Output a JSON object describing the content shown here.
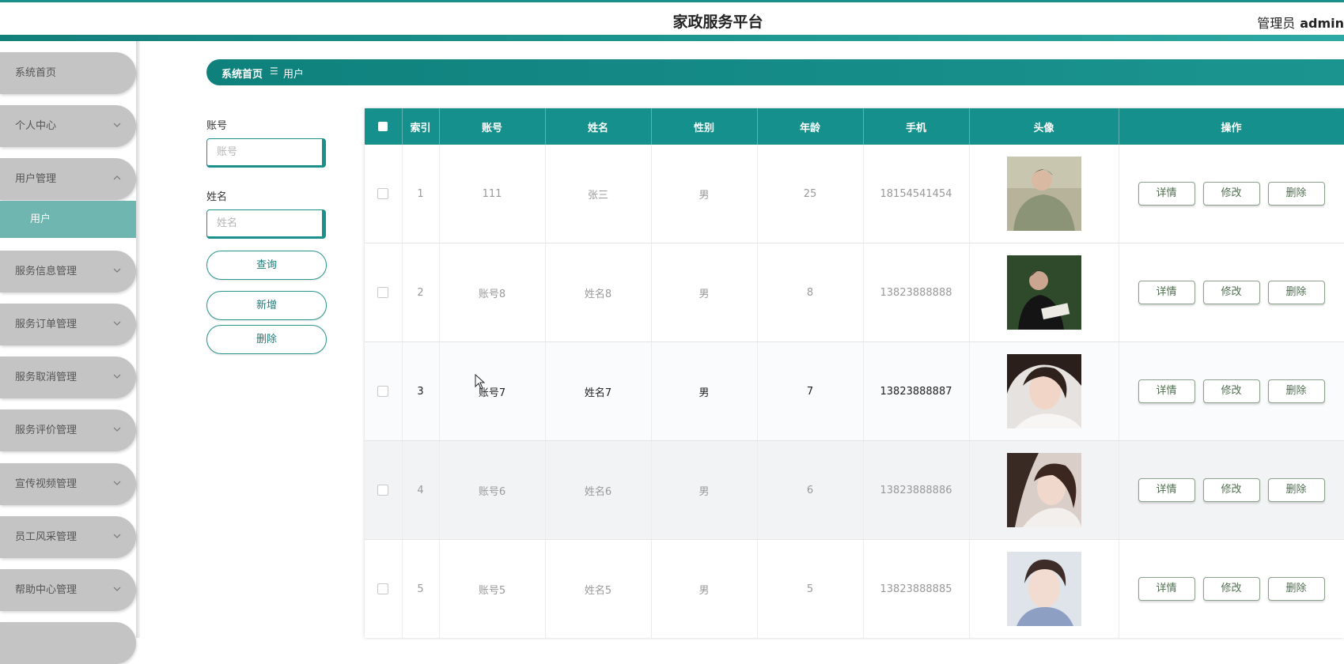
{
  "header": {
    "title": "家政服务平台",
    "role": "管理员",
    "username": "admin"
  },
  "sidebar": {
    "items": [
      {
        "label": "系统首页",
        "chevron": "none"
      },
      {
        "label": "个人中心",
        "chevron": "down"
      },
      {
        "label": "用户管理",
        "chevron": "up"
      },
      {
        "label": "服务信息管理",
        "chevron": "down"
      },
      {
        "label": "服务订单管理",
        "chevron": "down"
      },
      {
        "label": "服务取消管理",
        "chevron": "down"
      },
      {
        "label": "服务评价管理",
        "chevron": "down"
      },
      {
        "label": "宣传视频管理",
        "chevron": "down"
      },
      {
        "label": "员工风采管理",
        "chevron": "down"
      },
      {
        "label": "帮助中心管理",
        "chevron": "down"
      }
    ],
    "subitem": {
      "label": "用户"
    }
  },
  "breadcrumb": {
    "home": "系统首页",
    "separator": "☰",
    "current": "用户"
  },
  "search": {
    "account_label": "账号",
    "account_placeholder": "账号",
    "name_label": "姓名",
    "name_placeholder": "姓名",
    "query_button": "查询",
    "add_button": "新增",
    "delete_button": "删除"
  },
  "table": {
    "headers": [
      "索引",
      "账号",
      "姓名",
      "性别",
      "年龄",
      "手机",
      "头像",
      "操作"
    ],
    "rows": [
      {
        "index": "1",
        "account": "111",
        "name": "张三",
        "gender": "男",
        "age": "25",
        "phone": "18154541454"
      },
      {
        "index": "2",
        "account": "账号8",
        "name": "姓名8",
        "gender": "男",
        "age": "8",
        "phone": "13823888888"
      },
      {
        "index": "3",
        "account": "账号7",
        "name": "姓名7",
        "gender": "男",
        "age": "7",
        "phone": "13823888887"
      },
      {
        "index": "4",
        "account": "账号6",
        "name": "姓名6",
        "gender": "男",
        "age": "6",
        "phone": "13823888886"
      },
      {
        "index": "5",
        "account": "账号5",
        "name": "姓名5",
        "gender": "男",
        "age": "5",
        "phone": "13823888885"
      }
    ],
    "actions": {
      "detail": "详情",
      "edit": "修改",
      "delete": "删除"
    }
  },
  "colors": {
    "primary": "#16908c",
    "sidebar_item": "#c4c4c4",
    "submenu_active": "#6fb5b0"
  }
}
